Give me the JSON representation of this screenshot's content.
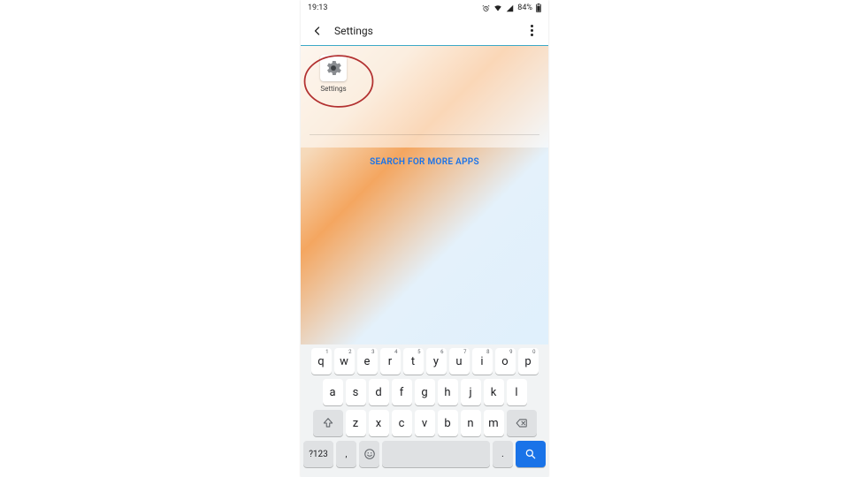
{
  "status": {
    "time": "19:13",
    "battery": "84%"
  },
  "appbar": {
    "title": "Settings"
  },
  "result": {
    "settings_label": "Settings"
  },
  "actions": {
    "search_more": "SEARCH FOR MORE APPS"
  },
  "keyboard": {
    "row1": [
      {
        "k": "q",
        "n": "1"
      },
      {
        "k": "w",
        "n": "2"
      },
      {
        "k": "e",
        "n": "3"
      },
      {
        "k": "r",
        "n": "4"
      },
      {
        "k": "t",
        "n": "5"
      },
      {
        "k": "y",
        "n": "6"
      },
      {
        "k": "u",
        "n": "7"
      },
      {
        "k": "i",
        "n": "8"
      },
      {
        "k": "o",
        "n": "9"
      },
      {
        "k": "p",
        "n": "0"
      }
    ],
    "row2": [
      "a",
      "s",
      "d",
      "f",
      "g",
      "h",
      "j",
      "k",
      "l"
    ],
    "row3": [
      "z",
      "x",
      "c",
      "v",
      "b",
      "n",
      "m"
    ],
    "symkey": "?123",
    "comma": ",",
    "period": "."
  }
}
